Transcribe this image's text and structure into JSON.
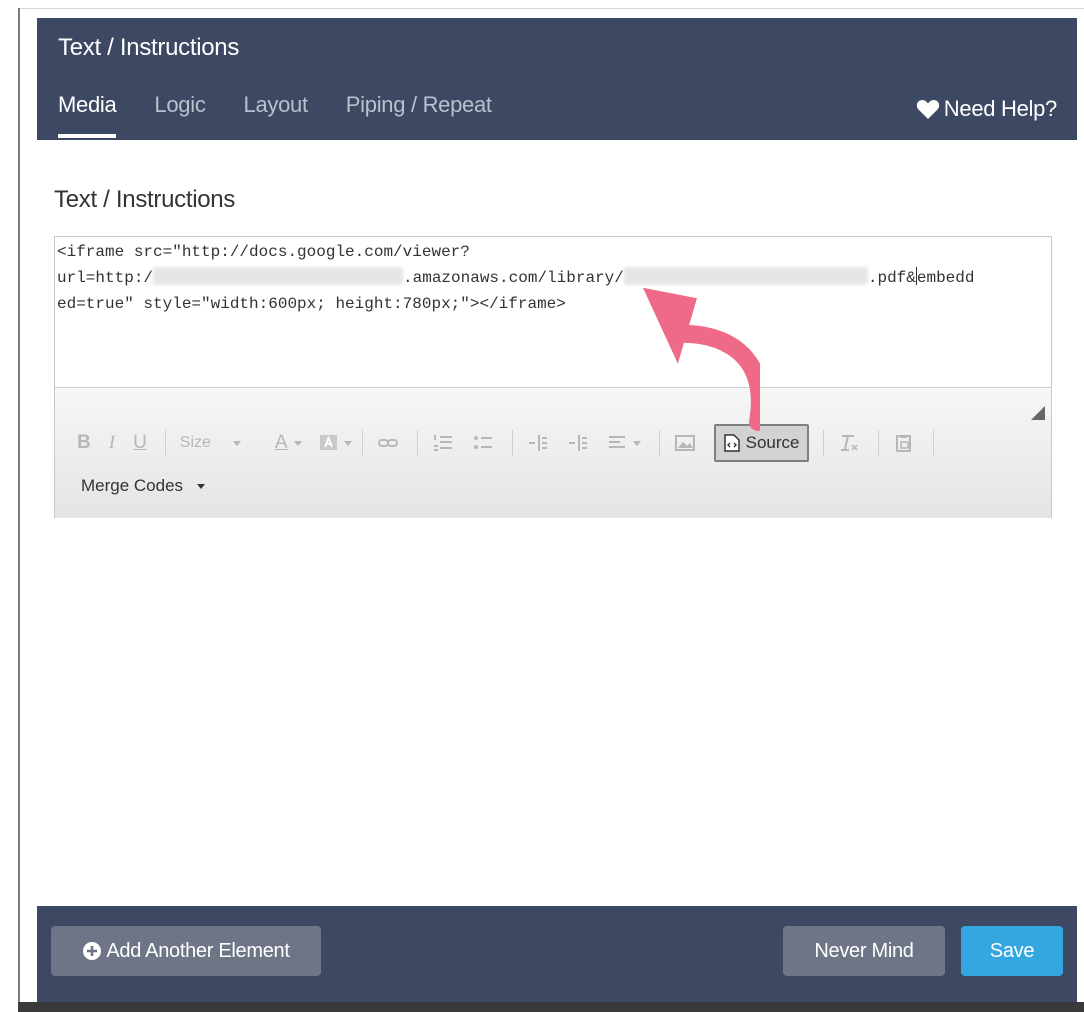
{
  "header": {
    "title": "Text / Instructions",
    "tabs": [
      {
        "label": "Media",
        "active": true
      },
      {
        "label": "Logic",
        "active": false
      },
      {
        "label": "Layout",
        "active": false
      },
      {
        "label": "Piping / Repeat",
        "active": false
      }
    ],
    "help_label": "Need Help?",
    "help_icon": "heart-icon"
  },
  "section": {
    "title": "Text / Instructions"
  },
  "editor": {
    "source_lines": {
      "line1": "<iframe src=\"http://docs.google.com/viewer?",
      "line2_a": "url=http:/",
      "line2_b": ".amazonaws.com/library/",
      "line2_c": ".pdf&",
      "line2_d": "embedd",
      "line3": "ed=true\" style=\"width:600px; height:780px;\"></iframe>"
    },
    "toolbar": {
      "bold": "B",
      "italic": "I",
      "underline": "U",
      "size": "Size",
      "font_color": "A",
      "source_label": "Source",
      "merge_codes": "Merge Codes"
    }
  },
  "footer": {
    "add_label": "Add Another Element",
    "never_mind_label": "Never Mind",
    "save_label": "Save"
  },
  "colors": {
    "header_bg": "#3d4862",
    "save_blue": "#34a7e0",
    "secondary_btn": "#6d7587",
    "annotation_pink": "#ee6a87"
  }
}
